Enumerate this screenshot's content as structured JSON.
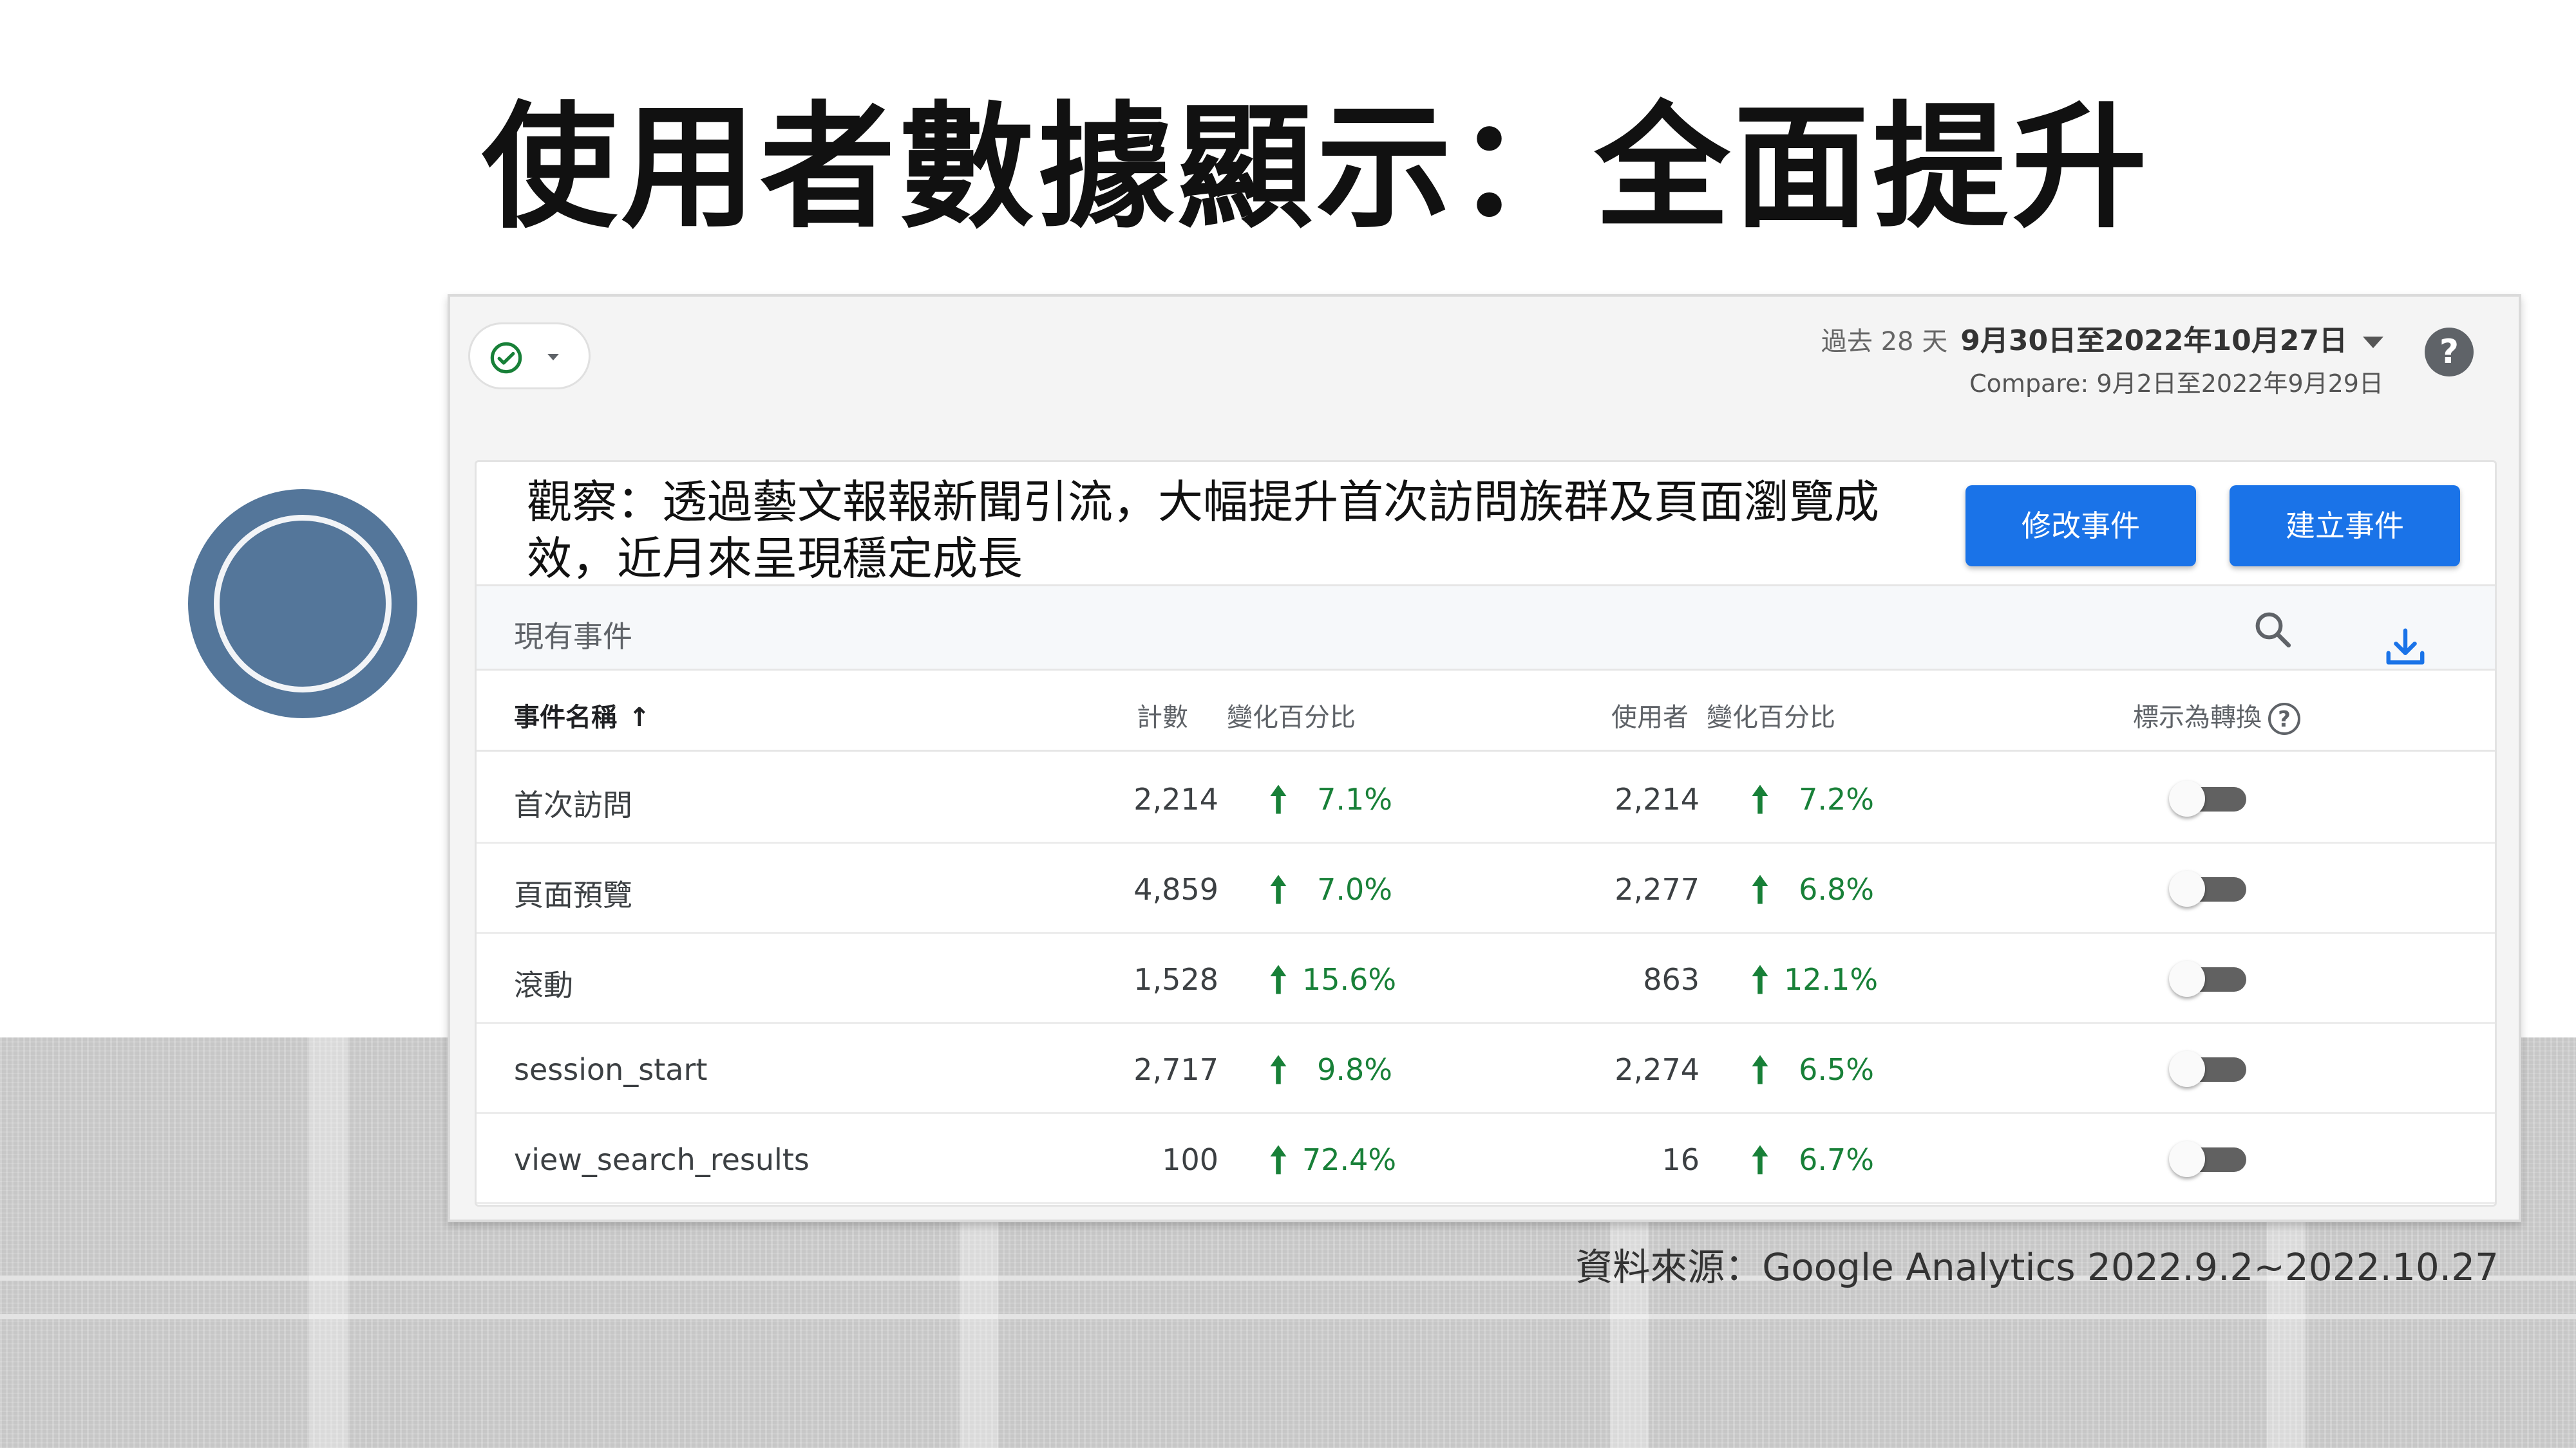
{
  "slide": {
    "title": "使用者數據顯示：全面提升",
    "source": "資料來源：Google Analytics 2022.9.2~2022.10.27"
  },
  "toolbar": {
    "date_prefix": "過去 28 天",
    "date_range": "9月30日至2022年10月27日",
    "compare": "Compare: 9月2日至2022年9月29日",
    "help_label": "?"
  },
  "card": {
    "observation": "觀察：透過藝文報報新聞引流，大幅提升首次訪問族群及頁面瀏覽成效，近月來呈現穩定成長",
    "modify_button": "修改事件",
    "create_button": "建立事件",
    "search_placeholder": "現有事件"
  },
  "table": {
    "headers": {
      "name": "事件名稱",
      "count": "計數",
      "count_change": "變化百分比",
      "users": "使用者",
      "users_change": "變化百分比",
      "conversion": "標示為轉換"
    },
    "rows": [
      {
        "name": "首次訪問",
        "count": "2,214",
        "count_change": "7.1%",
        "users": "2,214",
        "users_change": "7.2%"
      },
      {
        "name": "頁面預覽",
        "count": "4,859",
        "count_change": "7.0%",
        "users": "2,277",
        "users_change": "6.8%"
      },
      {
        "name": "滾動",
        "count": "1,528",
        "count_change": "15.6%",
        "users": "863",
        "users_change": "12.1%"
      },
      {
        "name": "session_start",
        "count": "2,717",
        "count_change": "9.8%",
        "users": "2,274",
        "users_change": "6.5%"
      },
      {
        "name": "view_search_results",
        "count": "100",
        "count_change": "72.4%",
        "users": "16",
        "users_change": "6.7%"
      }
    ]
  },
  "colors": {
    "accent": "#1a73e8",
    "positive": "#188038",
    "deco_circle": "#54769a"
  }
}
